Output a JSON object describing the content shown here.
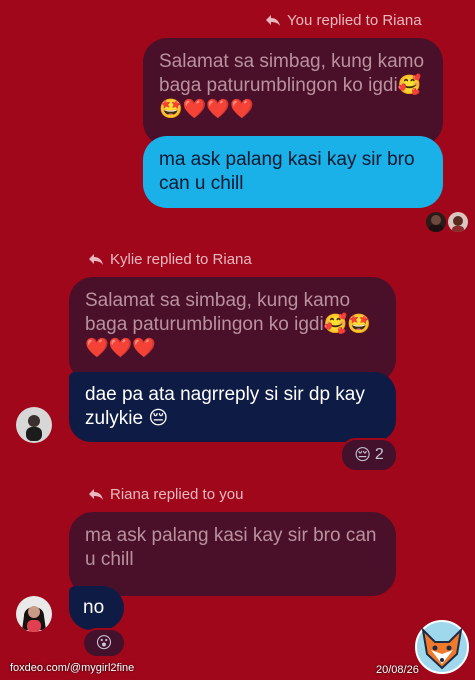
{
  "thread": {
    "reply1": {
      "header": "You replied to Riana",
      "quoted": "Salamat sa simbag, kung kamo baga paturumblingon ko igdi🥰🤩❤️❤️❤️",
      "message": "ma ask palang kasi kay sir bro can u chill"
    },
    "reply2": {
      "header": "Kylie replied to Riana",
      "quoted": "Salamat sa simbag, kung kamo baga paturumblingon ko igdi🥰🤩❤️❤️❤️",
      "message": "dae pa ata nagrreply si sir dp kay zulykie 😔",
      "reaction_emoji": "😔",
      "reaction_count": "2"
    },
    "reply3": {
      "header": "Riana replied to you",
      "quoted": "ma ask palang kasi kay sir bro can u chill",
      "message": "no",
      "reaction_emoji": "😮"
    }
  },
  "watermark": {
    "url": "foxdeo.com/@mygirl2fine",
    "date": "20/08/26"
  },
  "colors": {
    "background": "#a1071a",
    "quoted_bubble": "#4b1029",
    "sent_bubble": "#1ab0e8",
    "received_bubble": "#0e1b45"
  }
}
